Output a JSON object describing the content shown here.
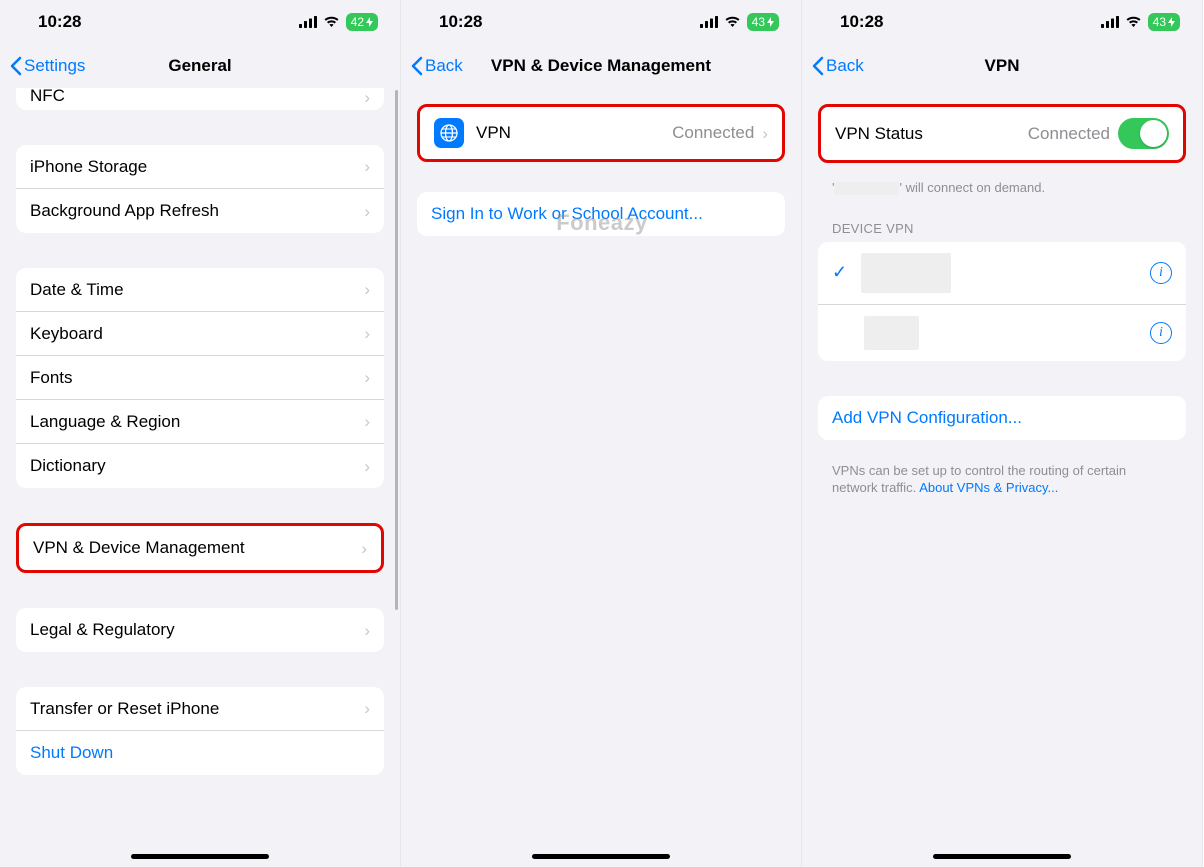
{
  "statusbar": {
    "time": "10:28",
    "battery_percent": "42",
    "battery_percent_p2": "43",
    "battery_percent_p3": "43"
  },
  "phone1": {
    "back_label": "Settings",
    "title": "General",
    "cutoff_row": "NFC",
    "group_a": [
      "iPhone Storage",
      "Background App Refresh"
    ],
    "group_b": [
      "Date & Time",
      "Keyboard",
      "Fonts",
      "Language & Region",
      "Dictionary"
    ],
    "vpn_row": "VPN & Device Management",
    "legal_row": "Legal & Regulatory",
    "reset_row": "Transfer or Reset iPhone",
    "shutdown_row": "Shut Down"
  },
  "phone2": {
    "back_label": "Back",
    "title": "VPN & Device Management",
    "vpn_label": "VPN",
    "vpn_detail": "Connected",
    "signin": "Sign In to Work or School Account..."
  },
  "phone3": {
    "back_label": "Back",
    "title": "VPN",
    "status_label": "VPN Status",
    "status_detail": "Connected",
    "demand_text": " will connect on demand.",
    "section_header": "DEVICE VPN",
    "add_config": "Add VPN Configuration...",
    "footer1": "VPNs can be set up to control the routing of certain network traffic. ",
    "footer_link": "About VPNs & Privacy..."
  },
  "watermark": "Foneazy"
}
